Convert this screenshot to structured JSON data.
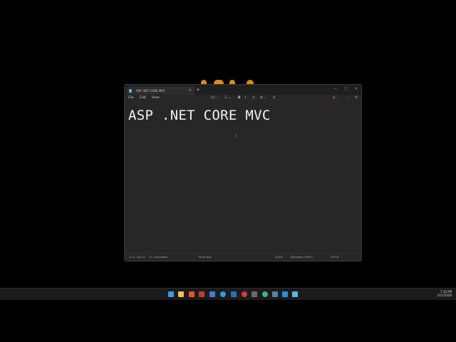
{
  "window": {
    "tab_title": "ASP .NET CORE MVC",
    "new_tab": "+",
    "tab_close": "×",
    "controls": {
      "minimize": "—",
      "maximize": "□",
      "close": "✕"
    }
  },
  "menu": {
    "file": "File",
    "edit": "Edit",
    "view": "View"
  },
  "toolbar": {
    "heading": "H1 ⌄",
    "list": "☰ ⌄",
    "bold": "B",
    "italic": "I",
    "link": "⊘",
    "table": "⊞ ⌄",
    "clear": "A̷",
    "copilot": "◐ ⌄",
    "more": "⋯",
    "settings": "⚙"
  },
  "document": {
    "text": "ASP .NET CORE MVC"
  },
  "cursor_glyph": "I",
  "status": {
    "position": "Ln 1, Col 17",
    "chars": "17 characters",
    "format": "Plain text",
    "zoom": "400%",
    "line_ending": "Windows (CRLF)",
    "encoding": "UTF-8"
  },
  "taskbar": {
    "time": "7:36 PM",
    "date": "2/21/2026",
    "icons": [
      "windows",
      "file-explorer",
      "brave",
      "app",
      "app",
      "edge",
      "app",
      "app",
      "app",
      "app",
      "app",
      "vscode",
      "notepad"
    ]
  },
  "colors": {
    "background": "#000000",
    "window": "#272727",
    "titlebar": "#1f1f1f",
    "text": "#f2f2f2",
    "taskbar": "#1b1b1b"
  }
}
